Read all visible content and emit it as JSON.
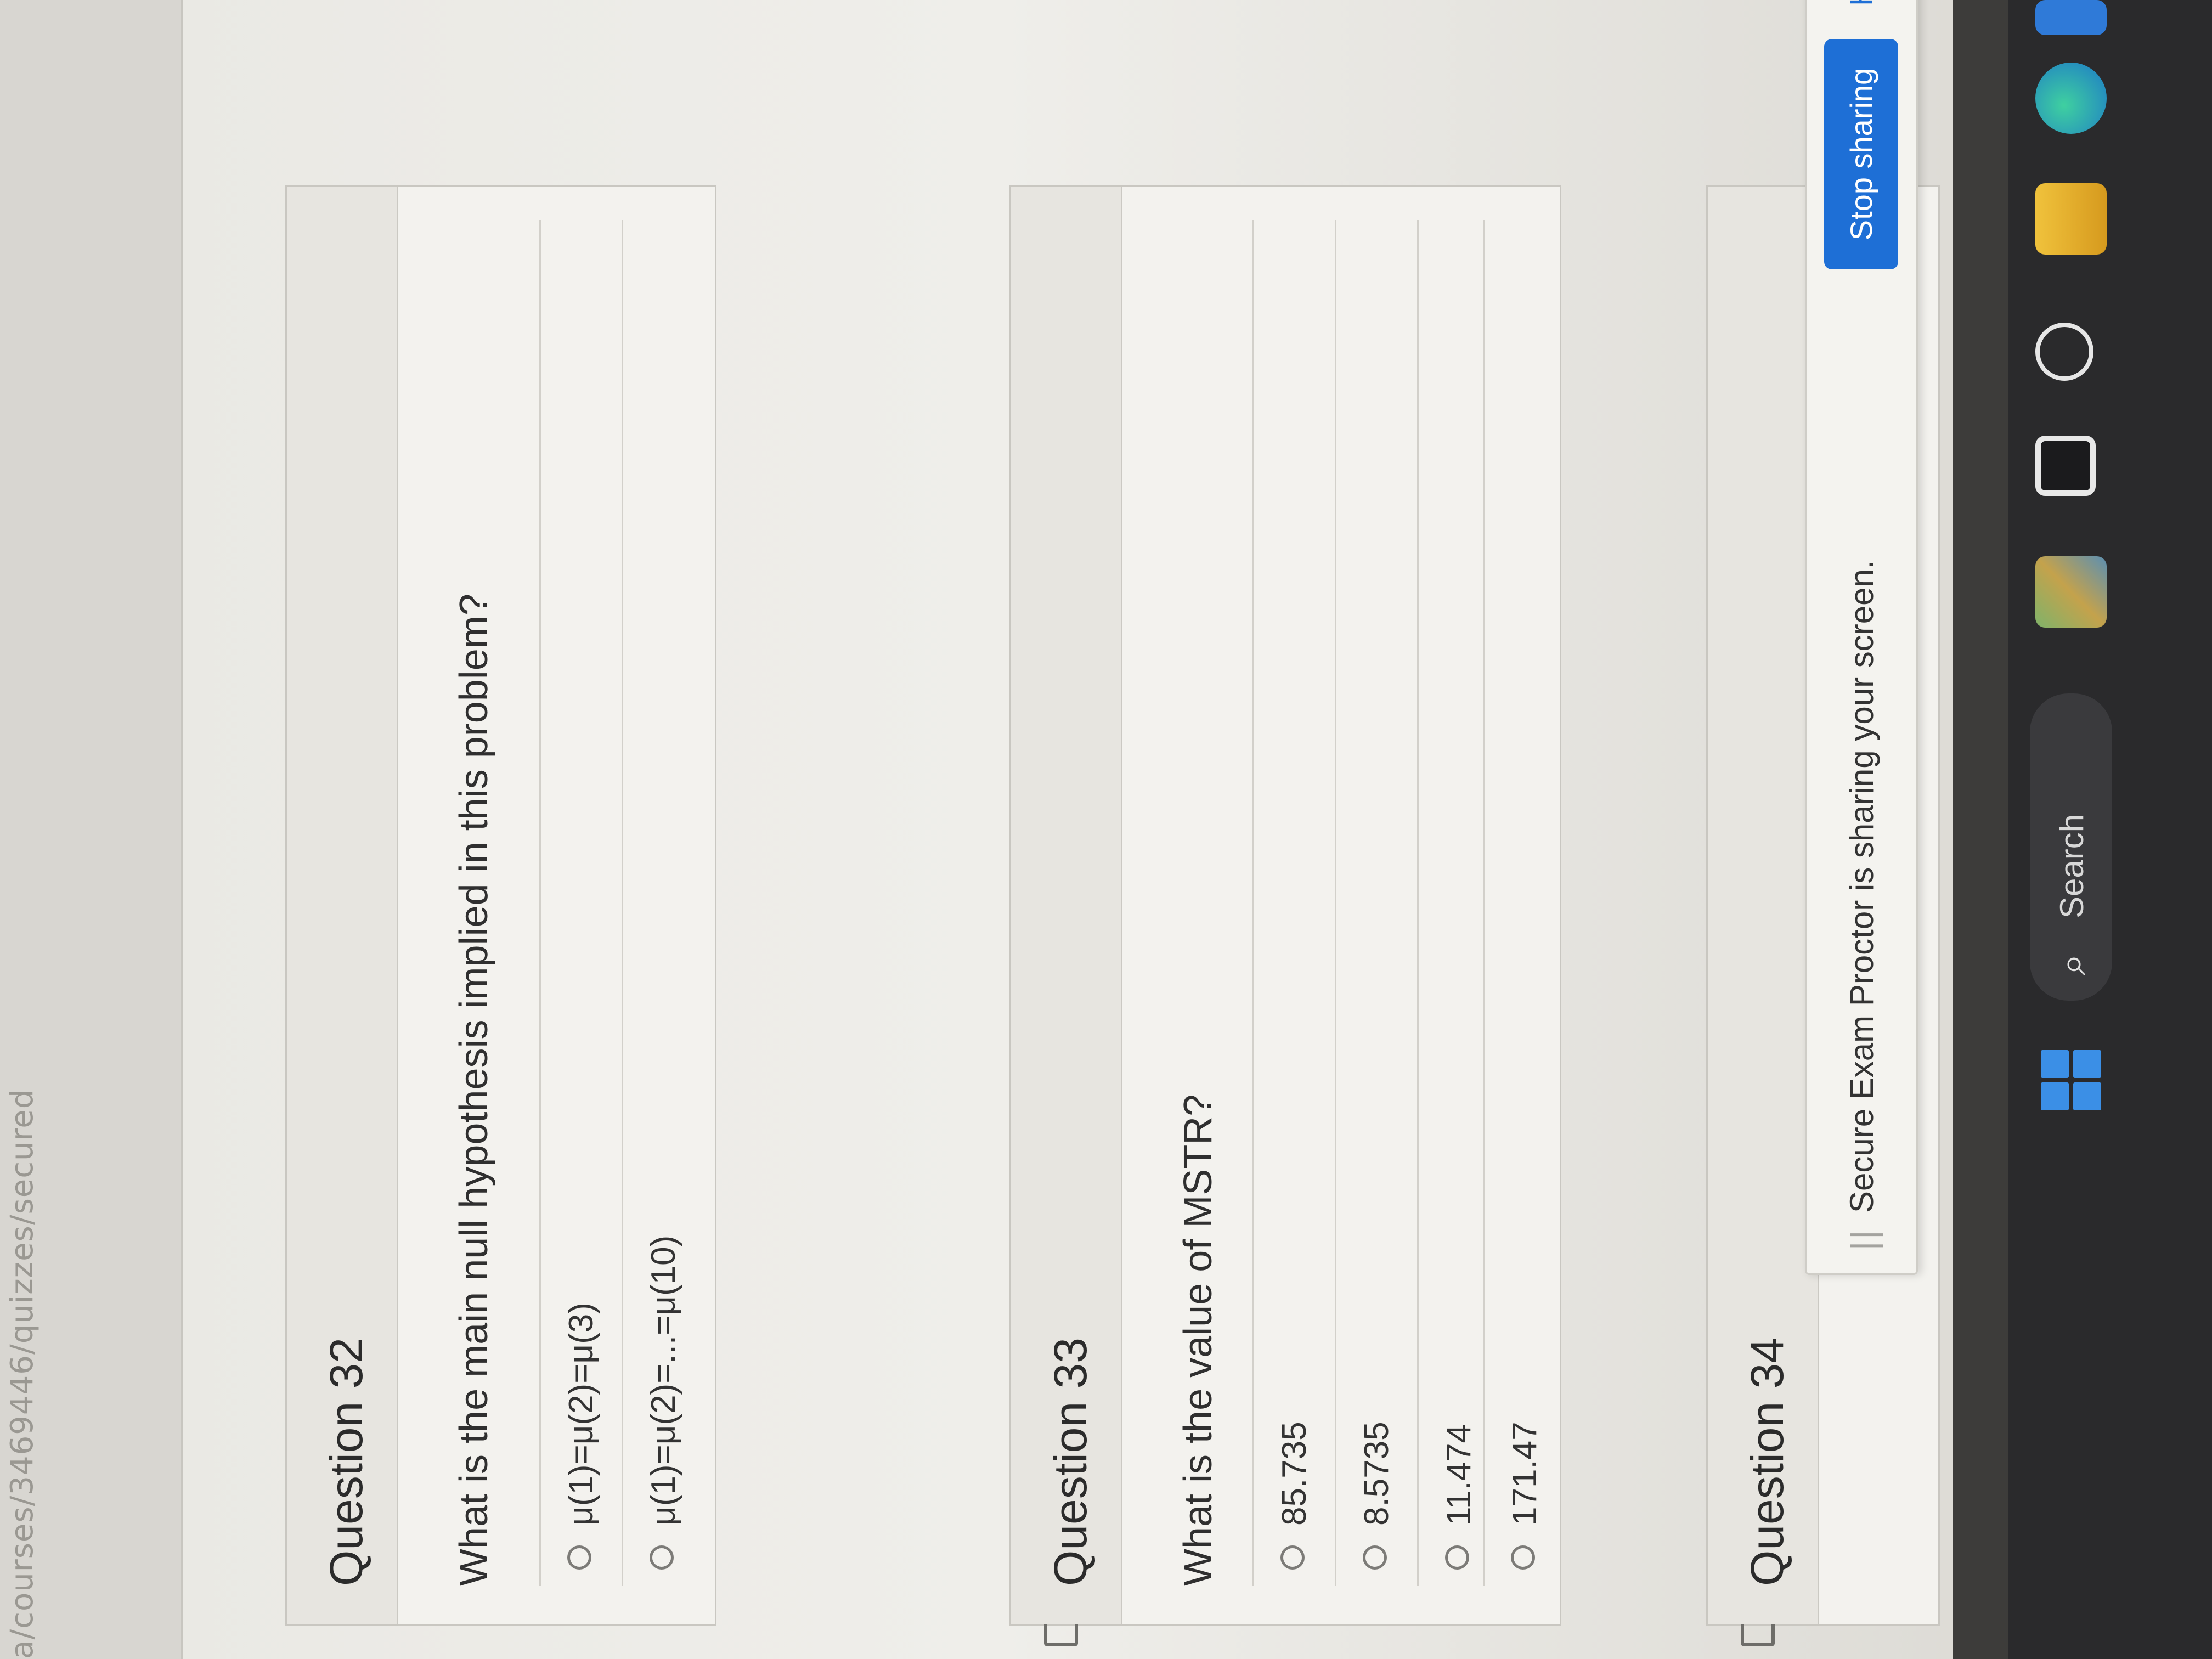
{
  "browser": {
    "url_fragment": "a/courses/3469446/quizzes/secured"
  },
  "questions": [
    {
      "title": "Question 32",
      "prompt": "What is the main null hypothesis implied in this problem?",
      "answers": [
        "μ(1)=μ(2)=μ(3)",
        "μ(1)=μ(2)=...=μ(10)"
      ]
    },
    {
      "title": "Question 33",
      "prompt": "What is the value of MSTR?",
      "answers": [
        "85.735",
        "8.5735",
        "11.474",
        "171.47"
      ]
    },
    {
      "title": "Question 34"
    }
  ],
  "share_bar": {
    "message": "Secure Exam Proctor is sharing your screen.",
    "stop_label": "Stop sharing",
    "hide_label": "Hide"
  },
  "taskbar": {
    "search_label": "Search",
    "icons": [
      "windows-start-icon",
      "search-icon",
      "widget-icon",
      "task-view-icon",
      "snipping-tool-icon",
      "file-explorer-icon",
      "edge-browser-icon",
      "app-icon"
    ]
  },
  "colors": {
    "accent": "#1e6fd6",
    "taskbar": "#2a2a2c",
    "card_header": "#e7e5e0"
  }
}
